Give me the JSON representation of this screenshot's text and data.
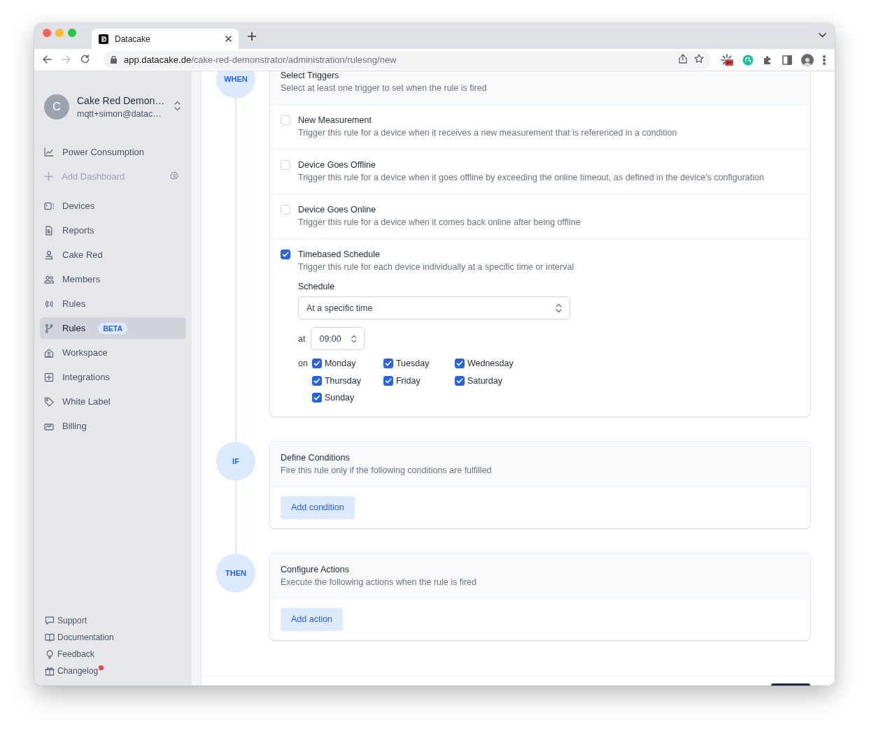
{
  "browser": {
    "tab": {
      "title": "Datacake"
    },
    "address": {
      "host": "app.datacake.de",
      "path": "/cake-red-demonstrator/administration/rulesng/new"
    },
    "extension_badge": "9+"
  },
  "sidebar": {
    "workspace": {
      "initial": "C",
      "name": "Cake Red Demon…",
      "email": "mqtt+simon@datac…"
    },
    "dashboards": [
      {
        "label": "Power Consumption",
        "kind": "dashboard"
      },
      {
        "label": "Add Dashboard",
        "kind": "add"
      }
    ],
    "nav": [
      {
        "label": "Devices",
        "selected": false
      },
      {
        "label": "Reports",
        "selected": false
      },
      {
        "label": "Cake Red",
        "selected": false
      },
      {
        "label": "Members",
        "selected": false
      },
      {
        "label": "Rules",
        "selected": false
      },
      {
        "label": "Rules",
        "selected": true,
        "badge": "BETA"
      },
      {
        "label": "Workspace",
        "selected": false
      },
      {
        "label": "Integrations",
        "selected": false
      },
      {
        "label": "White Label",
        "selected": false
      },
      {
        "label": "Billing",
        "selected": false
      }
    ],
    "footer": [
      {
        "label": "Support",
        "notification": false
      },
      {
        "label": "Documentation",
        "notification": false
      },
      {
        "label": "Feedback",
        "notification": false
      },
      {
        "label": "Changelog",
        "notification": true
      }
    ]
  },
  "steps": [
    {
      "marker": "WHEN",
      "kind": "triggers",
      "title": "Select Triggers",
      "subtitle": "Select at least one trigger to set when the rule is fired",
      "triggers": [
        {
          "title": "New Measurement",
          "description": "Trigger this rule for a device when it receives a new measurement that is referenced in a condition",
          "checked": false
        },
        {
          "title": "Device Goes Offline",
          "description": "Trigger this rule for a device when it goes offline by exceeding the online timeout, as defined in the device's configuration",
          "checked": false
        },
        {
          "title": "Device Goes Online",
          "description": "Trigger this rule for a device when it comes back online after being offline",
          "checked": false
        },
        {
          "title": "Timebased Schedule",
          "description": "Trigger this rule for each device individually at a specific time or interval",
          "checked": true,
          "schedule": {
            "label": "Schedule",
            "mode": "At a specific time",
            "at_label": "at",
            "time": "09:00",
            "on_label": "on",
            "days": [
              {
                "label": "Monday",
                "checked": true
              },
              {
                "label": "Tuesday",
                "checked": true
              },
              {
                "label": "Wednesday",
                "checked": true
              },
              {
                "label": "Thursday",
                "checked": true
              },
              {
                "label": "Friday",
                "checked": true
              },
              {
                "label": "Saturday",
                "checked": true
              },
              {
                "label": "Sunday",
                "checked": true
              }
            ]
          }
        }
      ]
    },
    {
      "marker": "IF",
      "kind": "button",
      "title": "Define Conditions",
      "subtitle": "Fire this rule only if the following conditions are fulfilled",
      "button": "Add condition"
    },
    {
      "marker": "THEN",
      "kind": "button",
      "title": "Configure Actions",
      "subtitle": "Execute the following actions when the rule is fired",
      "button": "Add action"
    }
  ]
}
